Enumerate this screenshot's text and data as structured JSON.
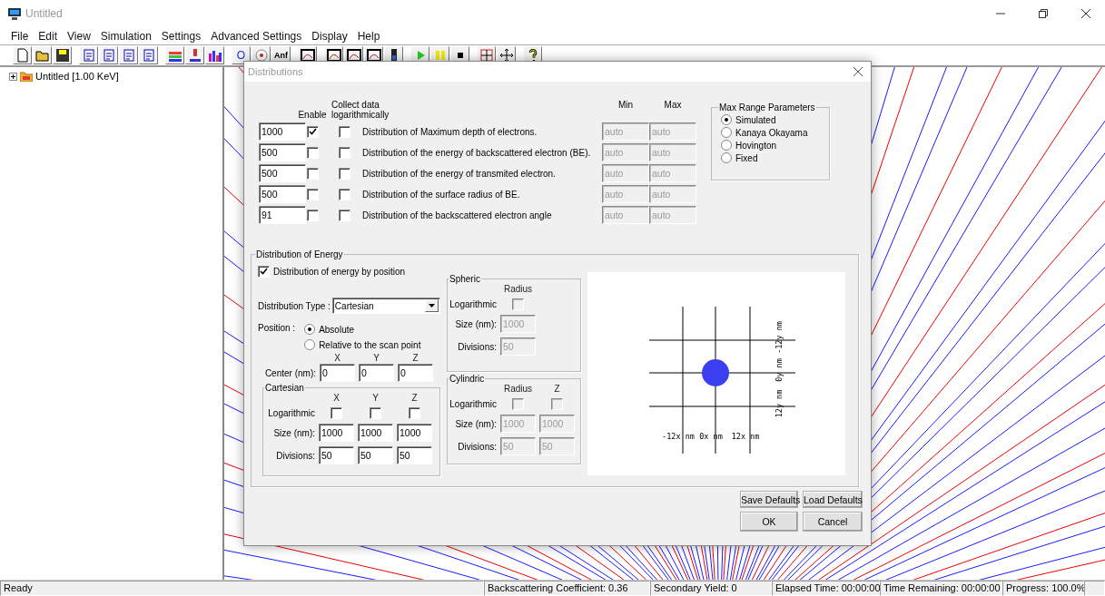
{
  "window": {
    "title": "Untitled"
  },
  "menu": [
    "File",
    "Edit",
    "View",
    "Simulation",
    "Settings",
    "Advanced Settings",
    "Display",
    "Help"
  ],
  "toolbar": {
    "circle_button": "O",
    "anf_button": "Anf"
  },
  "tree": [
    {
      "label": "Untitled [1.00 KeV]",
      "expanded": false
    }
  ],
  "dialog": {
    "title": "Distributions",
    "headers": {
      "enable": "Enable",
      "log_line_1": "Collect data",
      "log_line_2": "logarithmically",
      "min": "Min",
      "max": "Max"
    },
    "range_disabled": true,
    "rows": [
      {
        "count": "1000",
        "enabled": true,
        "logarithmic": false,
        "label": "Distribution of Maximum depth of electrons.",
        "min": "auto",
        "max": "auto"
      },
      {
        "count": "500",
        "enabled": false,
        "logarithmic": false,
        "label": "Distribution of the energy of backscattered electron (BE).",
        "min": "auto",
        "max": "auto"
      },
      {
        "count": "500",
        "enabled": false,
        "logarithmic": false,
        "label": "Distribution of the energy of transmited electron.",
        "min": "auto",
        "max": "auto"
      },
      {
        "count": "500",
        "enabled": false,
        "logarithmic": false,
        "label": "Distribution of the surface radius of BE.",
        "min": "auto",
        "max": "auto"
      },
      {
        "count": "91",
        "enabled": false,
        "logarithmic": false,
        "label": "Distribution of the backscattered electron angle",
        "min": "auto",
        "max": "auto"
      }
    ],
    "max_range": {
      "title": "Max Range Parameters",
      "options": [
        {
          "label": "Simulated",
          "selected": true
        },
        {
          "label": "Kanaya  Okayama",
          "selected": false
        },
        {
          "label": "Hovington",
          "selected": false
        },
        {
          "label": "Fixed",
          "selected": false
        }
      ]
    },
    "energy": {
      "title": "Distribution of Energy",
      "by_position": {
        "label": "Distribution of energy by position",
        "checked": true
      },
      "type_label": "Distribution Type :",
      "type_value": "Cartesian",
      "position_label": "Position :",
      "positions": [
        {
          "label": "Absolute",
          "selected": true
        },
        {
          "label": "Relative to the scan point",
          "selected": false
        }
      ],
      "center": {
        "axes": [
          "X",
          "Y",
          "Z"
        ],
        "label": "Center (nm):",
        "values": [
          "0",
          "0",
          "0"
        ]
      },
      "cartesian": {
        "title": "Cartesian",
        "disabled": false,
        "axes": [
          "X",
          "Y",
          "Z"
        ],
        "log_label": "Logarithmic",
        "log": [
          {
            "checked": false
          },
          {
            "checked": false
          },
          {
            "checked": false
          }
        ],
        "size_label": "Size (nm):",
        "sizes": [
          "1000",
          "1000",
          "1000"
        ],
        "divisions_label": "Divisions:",
        "divisions": [
          "50",
          "50",
          "50"
        ]
      },
      "spheric": {
        "title": "Spheric",
        "disabled": true,
        "axes": [
          "Radius"
        ],
        "log_label": "Logarithmic",
        "log": [
          {
            "checked": false
          }
        ],
        "size_label": "Size (nm):",
        "sizes": [
          "1000"
        ],
        "divisions_label": "Divisions:",
        "divisions": [
          "50"
        ]
      },
      "cylindric": {
        "title": "Cylindric",
        "disabled": true,
        "axes": [
          "Radius",
          "Z"
        ],
        "log_label": "Logarithmic",
        "log": [
          {
            "checked": false
          },
          {
            "checked": false
          }
        ],
        "size_label": "Size (nm):",
        "sizes": [
          "1000",
          "1000"
        ],
        "divisions_label": "Divisions:",
        "divisions": [
          "50",
          "50"
        ]
      }
    },
    "preview": {
      "x_labels": [
        "-12x nm",
        "0x nm",
        "12x nm"
      ],
      "y_labels": [
        "-12y nm",
        "0y nm",
        "12y nm"
      ]
    },
    "buttons": [
      "Save Defaults",
      "Load Defaults",
      "OK",
      "Cancel"
    ]
  },
  "status_bar": [
    "Ready",
    "Backscattering Coefficient: 0.36",
    "Secondary Yield: 0",
    "Elapsed Time: 00:00:00",
    "Time Remaining: 00:00:00",
    "Progress: 100.0%"
  ]
}
